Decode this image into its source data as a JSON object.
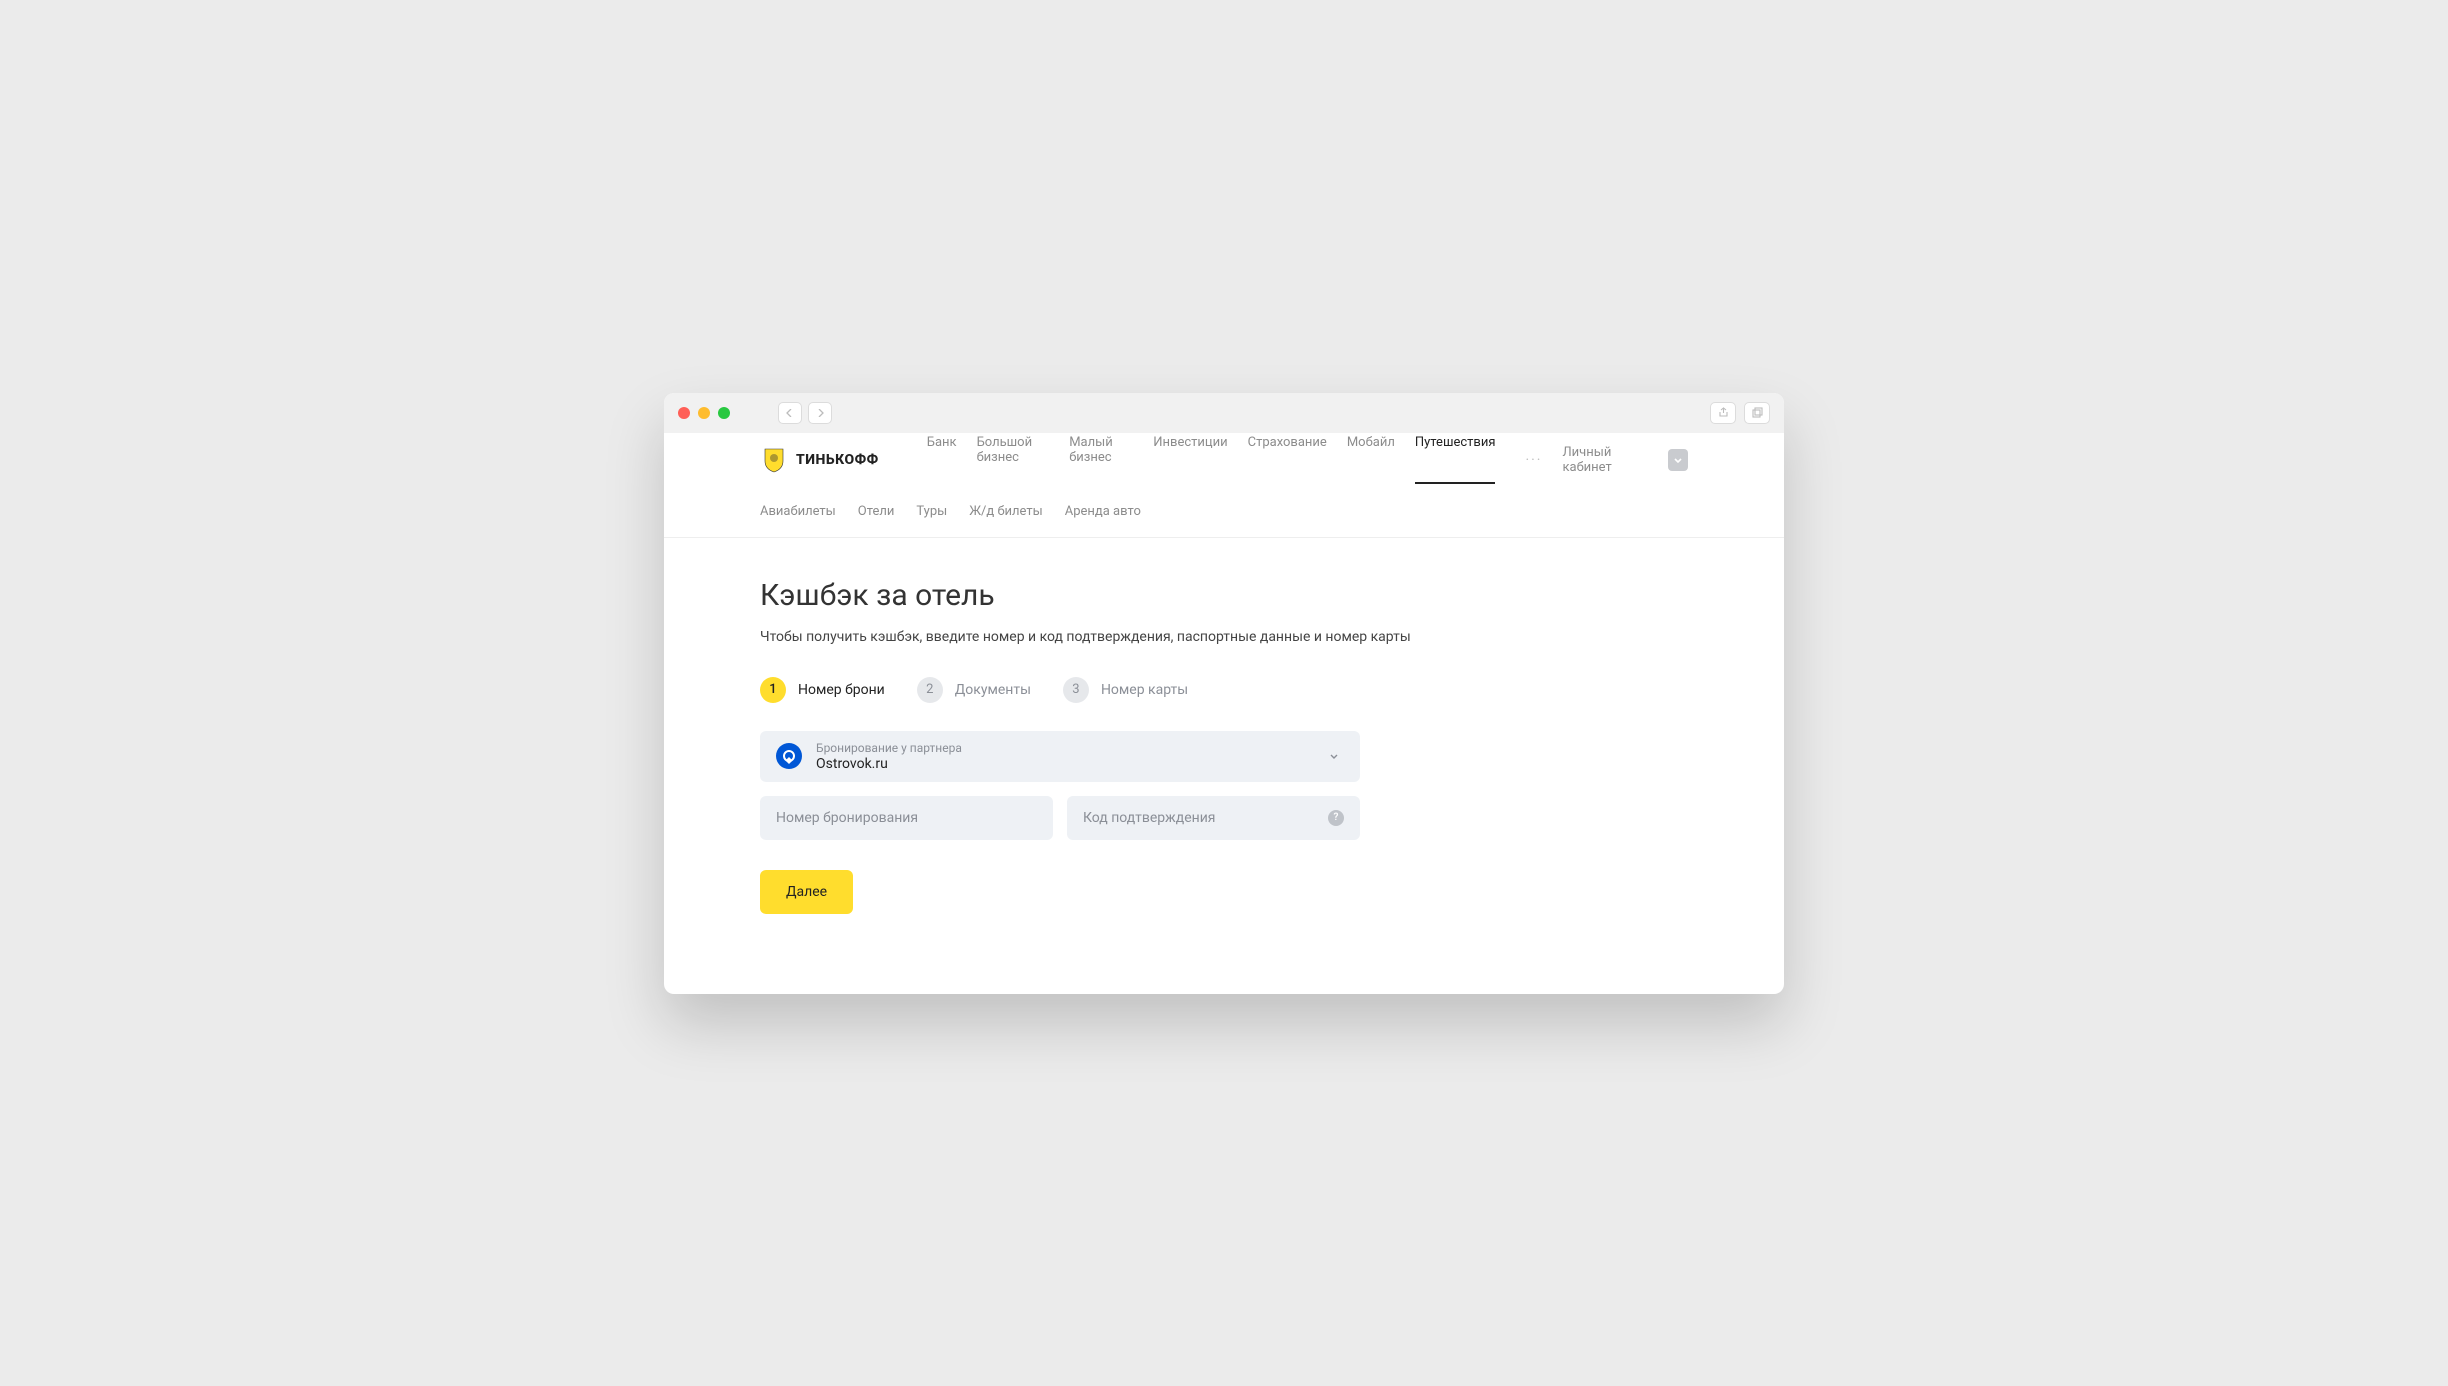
{
  "logo": {
    "text": "ТИНЬКОФФ"
  },
  "header": {
    "nav": [
      {
        "label": "Банк",
        "active": false
      },
      {
        "label": "Большой бизнес",
        "active": false
      },
      {
        "label": "Малый бизнес",
        "active": false
      },
      {
        "label": "Инвестиции",
        "active": false
      },
      {
        "label": "Страхование",
        "active": false
      },
      {
        "label": "Мобайл",
        "active": false
      },
      {
        "label": "Путешествия",
        "active": true
      }
    ],
    "more": "···",
    "cabinet": "Личный кабинет"
  },
  "subnav": [
    {
      "label": "Авиабилеты"
    },
    {
      "label": "Отели"
    },
    {
      "label": "Туры"
    },
    {
      "label": "Ж/д билеты"
    },
    {
      "label": "Аренда авто"
    }
  ],
  "page": {
    "title": "Кэшбэк за отель",
    "subtitle": "Чтобы получить кэшбэк, введите номер и код подтверждения, паспортные данные и номер карты"
  },
  "stepper": [
    {
      "num": "1",
      "label": "Номер брони",
      "active": true
    },
    {
      "num": "2",
      "label": "Документы",
      "active": false
    },
    {
      "num": "3",
      "label": "Номер карты",
      "active": false
    }
  ],
  "form": {
    "partner_select": {
      "label": "Бронирование у партнера",
      "value": "Ostrovok.ru"
    },
    "booking_number": {
      "placeholder": "Номер бронирования",
      "value": ""
    },
    "confirmation_code": {
      "placeholder": "Код подтверждения",
      "value": ""
    },
    "submit_label": "Далее"
  }
}
